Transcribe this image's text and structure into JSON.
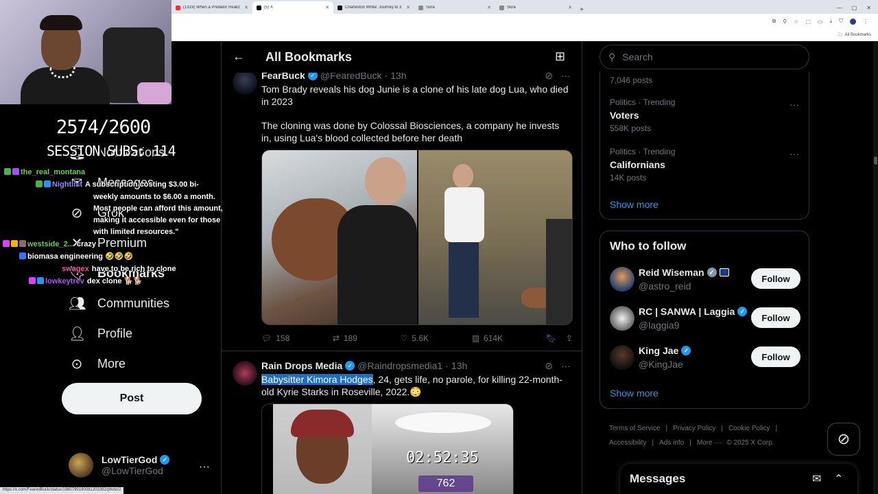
{
  "browser": {
    "tabs": [
      {
        "title": "(1319) When a Predator Realiz",
        "active": false,
        "favicon": "youtube-icon"
      },
      {
        "title": "(5) X",
        "active": true,
        "favicon": "x-icon"
      },
      {
        "title": "Charleston White: Journey to 3",
        "active": false,
        "favicon": "x-icon"
      },
      {
        "title": "Sora",
        "active": false,
        "favicon": "sora-icon"
      },
      {
        "title": "Sora",
        "active": false,
        "favicon": "sora-icon"
      }
    ],
    "bookmarks_label": "All Bookmarks",
    "status_url": "https://x.com/FearedBuck/status/1985799190081203392/photo/2"
  },
  "overlay": {
    "counter": "2574/2600",
    "session": "SESSION SUBS: 114",
    "chat": [
      {
        "user": "the_real_montana",
        "color": "#62d341",
        "text": "",
        "badges": [
          "#4caf50",
          "#a64dff"
        ]
      },
      {
        "user": "Nightlist",
        "color": "#8a8aff",
        "text": "A subscription costing $3.00 bi-",
        "badges": [
          "#4caf50",
          "#2196f3"
        ]
      },
      {
        "user": "",
        "color": "#fff",
        "text": "weekly amounts to $6.00 a month.",
        "badges": []
      },
      {
        "user": "",
        "color": "#fff",
        "text": "Most people can afford this amount,",
        "badges": []
      },
      {
        "user": "",
        "color": "#fff",
        "text": "making it accessible even for those",
        "badges": []
      },
      {
        "user": "",
        "color": "#fff",
        "text": "with limited resources.\"",
        "badges": []
      },
      {
        "user": "westside_2...",
        "color": "#62d341",
        "text": "crazy",
        "badges": [
          "#e040fb",
          "#ffb300",
          "#8d6e63"
        ]
      },
      {
        "user": "",
        "color": "#3a6ff7",
        "text": "biomasa engineering 🤣🤣🤣",
        "badges": [
          "#3a6ff7"
        ]
      },
      {
        "user": "swagex",
        "color": "#ff4fa3",
        "text": "have to be rich to clone",
        "badges": []
      },
      {
        "user": "lowkeytrev",
        "color": "#b04fff",
        "text": "dex clone 🐕🐕",
        "badges": [
          "#e040fb",
          "#2196f3"
        ]
      }
    ]
  },
  "nav": {
    "items": [
      {
        "label": "Notifications",
        "icon": "bell-icon"
      },
      {
        "label": "Messages",
        "icon": "envelope-icon"
      },
      {
        "label": "Grok",
        "icon": "grok-icon"
      },
      {
        "label": "Premium",
        "icon": "x-premium-icon"
      },
      {
        "label": "Bookmarks",
        "icon": "bookmark-icon"
      },
      {
        "label": "Communities",
        "icon": "communities-icon"
      },
      {
        "label": "Profile",
        "icon": "profile-icon"
      },
      {
        "label": "More",
        "icon": "more-circle-icon"
      }
    ],
    "post_label": "Post",
    "account": {
      "name": "LowTierGod",
      "handle": "@LowTierGod"
    }
  },
  "main": {
    "title": "All Bookmarks",
    "tweets": [
      {
        "name": "FearBuck",
        "handle": "@FearedBuck",
        "time": "13h",
        "text_1": "Tom Brady reveals his dog Junie is a clone of his late dog Lua, who died in 2023",
        "text_2": "The cloning was done by Colossal Biosciences, a company he invests in, using Lua's blood collected before her death",
        "replies": "158",
        "reposts": "189",
        "likes": "5.6K",
        "views": "614K"
      },
      {
        "name": "Rain Drops Media",
        "handle": "@Raindropsmedia1",
        "time": "13h",
        "text_highlight": "Babysitter Kimora Hodges",
        "text_rest": ", 24, gets life, no parole, for killing 22-month-old Kyrie Starks in Roseville, 2022.😳",
        "media_clock": "02:52:35",
        "media_counter": "762"
      }
    ]
  },
  "right": {
    "search_placeholder": "Search",
    "trends_top_count": "7,046 posts",
    "trends": [
      {
        "category": "Politics · Trending",
        "name": "Voters",
        "count": "558K posts"
      },
      {
        "category": "Politics · Trending",
        "name": "Californians",
        "count": "14K posts"
      }
    ],
    "show_more": "Show more",
    "who_to_follow": {
      "title": "Who to follow",
      "accounts": [
        {
          "name": "Reid Wiseman",
          "handle": "@astro_reid",
          "verified": "gray"
        },
        {
          "name": "RC | SANWA | Laggia",
          "handle": "@laggia9",
          "verified": "blue"
        },
        {
          "name": "King Jae",
          "handle": "@KingJae",
          "verified": "blue"
        }
      ],
      "follow_label": "Follow",
      "show_more": "Show more"
    },
    "footer": {
      "links": [
        "Terms of Service",
        "|",
        "Privacy Policy",
        "|",
        "Cookie Policy",
        "|",
        "Accessibility",
        "|",
        "Ads info",
        "|",
        "More ···",
        "© 2025 X Corp."
      ]
    },
    "messages_label": "Messages"
  }
}
